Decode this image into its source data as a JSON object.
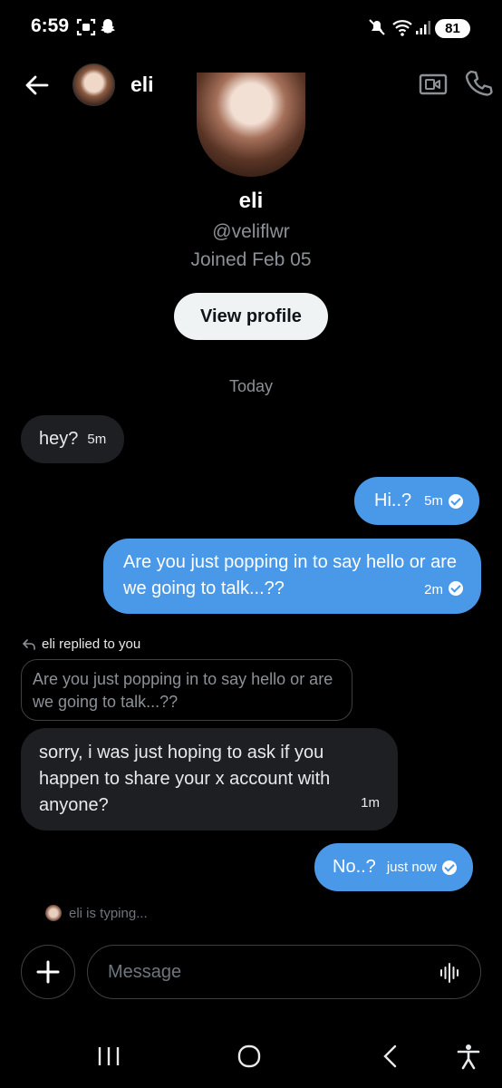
{
  "status_bar": {
    "time": "6:59",
    "battery": "81"
  },
  "header": {
    "name": "eli"
  },
  "profile": {
    "name": "eli",
    "handle": "@veliflwr",
    "joined": "Joined Feb 05",
    "view_profile_label": "View profile"
  },
  "divider": "Today",
  "messages": [
    {
      "from": "them",
      "text": "hey?",
      "time": "5m"
    },
    {
      "from": "me",
      "text": "Hi..?",
      "time": "5m",
      "read": true
    },
    {
      "from": "me",
      "text": "Are you just popping in to say hello or are we going to talk...??",
      "time": "2m",
      "read": true
    },
    {
      "from": "them",
      "text": "sorry, i was just hoping to ask if you happen to share your x account with anyone?",
      "time": "1m",
      "reply_label": "eli replied to you",
      "quoted": "Are you just popping in to say hello or are we going to talk...??"
    },
    {
      "from": "me",
      "text": "No..?",
      "time": "just now",
      "read": true
    }
  ],
  "typing": "eli is typing...",
  "composer": {
    "placeholder": "Message"
  },
  "colors": {
    "background": "#000000",
    "outgoing_bubble": "#4a99e9",
    "incoming_bubble": "#1d1f23",
    "muted_text": "#8b9196"
  }
}
